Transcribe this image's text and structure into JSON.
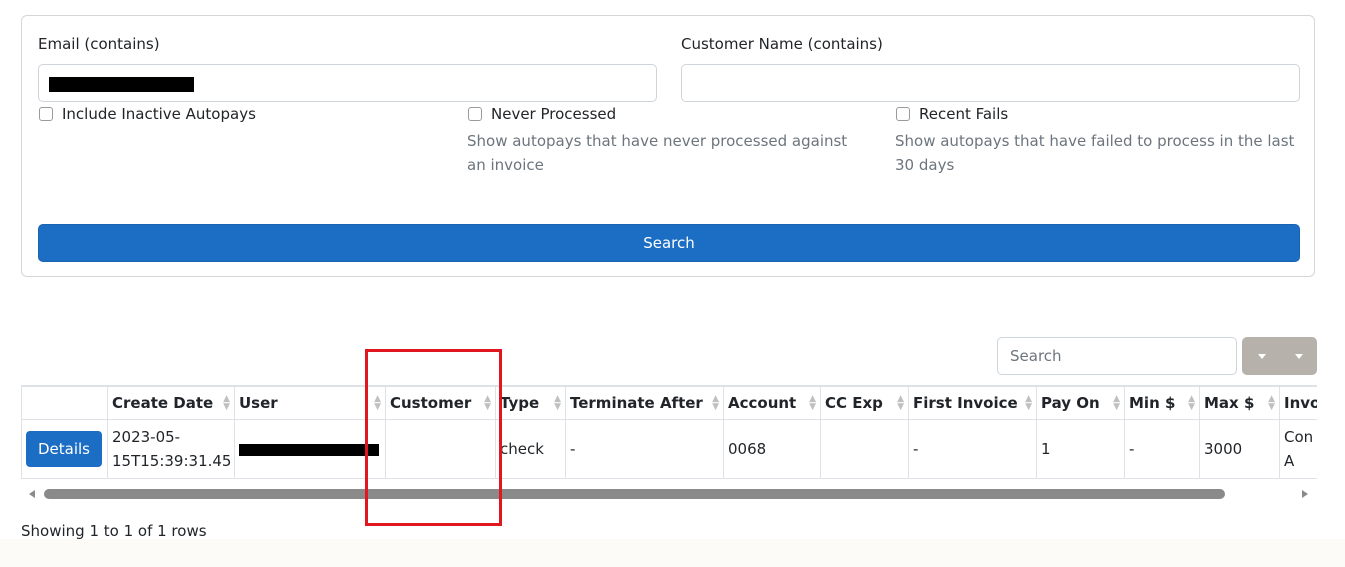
{
  "filters": {
    "email_label": "Email (contains)",
    "email_value": "",
    "customer_label": "Customer Name (contains)",
    "customer_value": "",
    "include_inactive_label": "Include Inactive Autopays",
    "never_processed_label": "Never Processed",
    "never_processed_help": "Show autopays that have never processed against an invoice",
    "recent_fails_label": "Recent Fails",
    "recent_fails_help": "Show autopays that have failed to process in the last 30 days",
    "search_button": "Search"
  },
  "toolbar": {
    "search_placeholder": "Search"
  },
  "table": {
    "columns": [
      "",
      "Create Date",
      "User",
      "Customer",
      "Type",
      "Terminate After",
      "Account",
      "CC Exp",
      "First Invoice",
      "Pay On",
      "Min $",
      "Max $",
      "Invo"
    ],
    "row": {
      "action": "Details",
      "create_date": "2023-05-15T15:39:31.45",
      "customer": "",
      "type": "check",
      "terminate_after": "-",
      "account": "0068",
      "cc_exp": "",
      "first_invoice": "-",
      "pay_on": "1",
      "min": "-",
      "max": "3000",
      "invoice": "Con SO, A"
    }
  },
  "footer": {
    "showing": "Showing 1 to 1 of 1 rows"
  },
  "colors": {
    "primary": "#1c6ec4",
    "highlight": "#e0171f",
    "toolbar_button": "#b6b1aa"
  }
}
